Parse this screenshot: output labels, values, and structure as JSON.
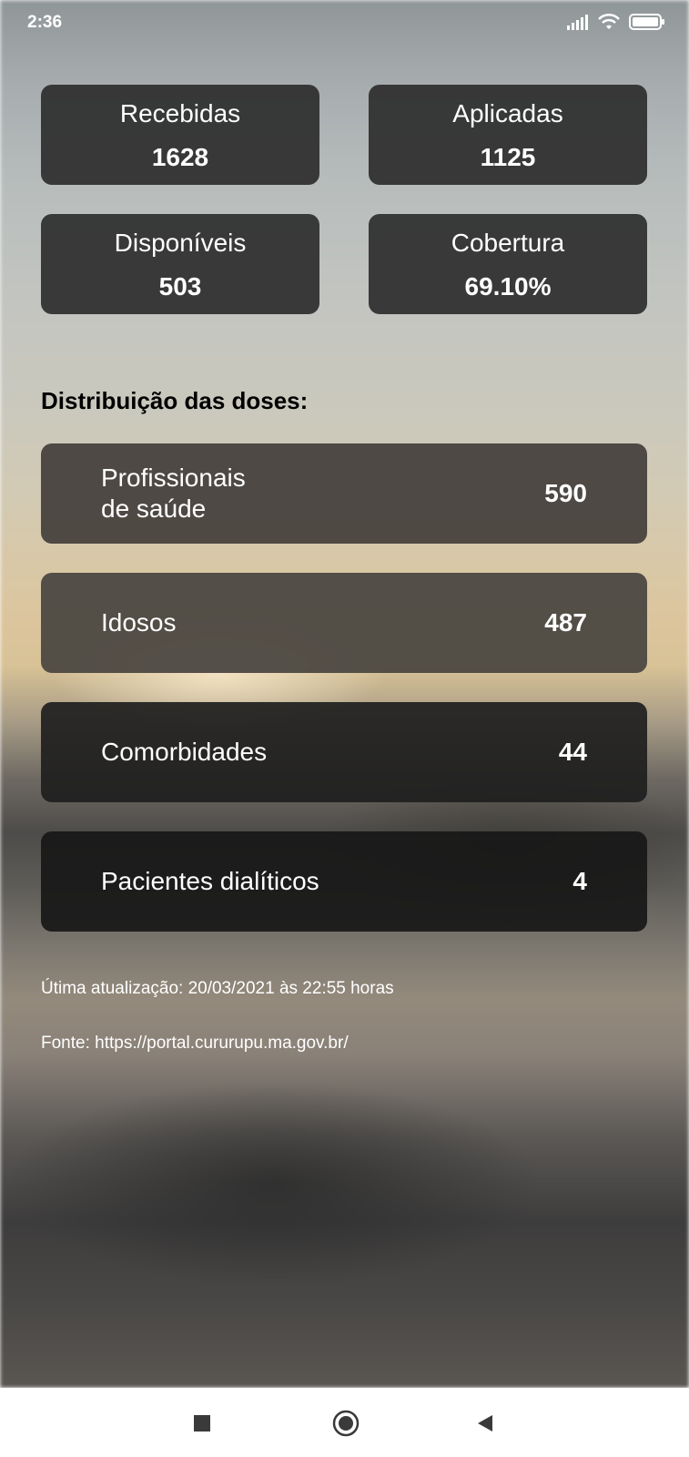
{
  "status_bar": {
    "time": "2:36",
    "icons": [
      "signal-icon",
      "wifi-icon",
      "battery-icon"
    ]
  },
  "summary_cards": [
    {
      "label": "Recebidas",
      "value": "1628"
    },
    {
      "label": "Aplicadas",
      "value": "1125"
    },
    {
      "label": "Disponíveis",
      "value": "503"
    },
    {
      "label": "Cobertura",
      "value": "69.10%"
    }
  ],
  "distribution": {
    "title": "Distribuição das doses:",
    "items": [
      {
        "label_line1": "Profissionais",
        "label_line2": "de saúde",
        "value": "590"
      },
      {
        "label": "Idosos",
        "value": "487"
      },
      {
        "label": "Comorbidades",
        "value": "44"
      },
      {
        "label": "Pacientes dialíticos",
        "value": "4"
      }
    ]
  },
  "footer": {
    "last_update": "Útima atualização: 20/03/2021 às 22:55 horas",
    "source": "Fonte: https://portal.cururupu.ma.gov.br/"
  },
  "nav_bar": {
    "icons": [
      "recents-square-icon",
      "home-circle-icon",
      "back-triangle-icon"
    ]
  }
}
